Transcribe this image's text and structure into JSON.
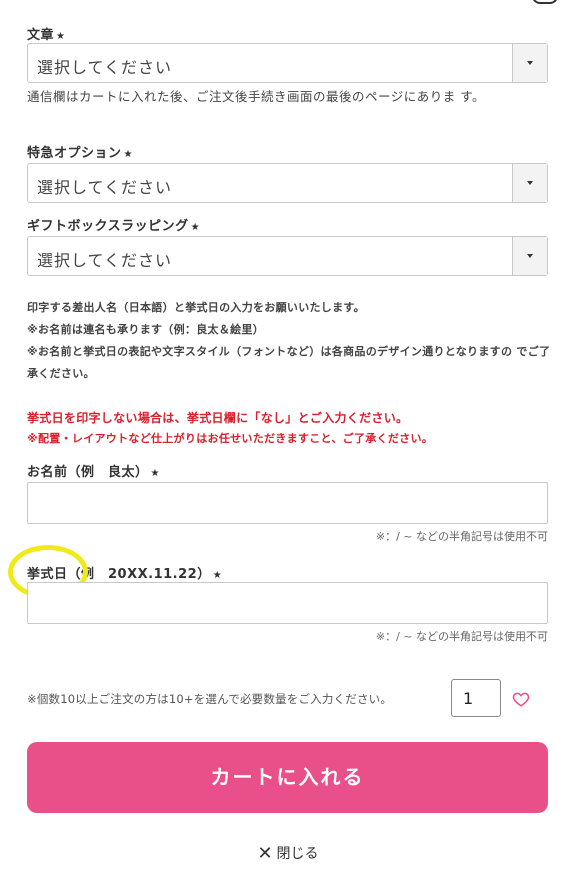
{
  "fields": {
    "sentence": {
      "label": "文章",
      "required_mark": "★",
      "selected": "選択してください",
      "note": "通信欄はカートに入れた後、ご注文後手続き画面の最後のページにありま す。"
    },
    "express": {
      "label": "特急オプション",
      "required_mark": "★",
      "selected": "選択してください"
    },
    "giftbox": {
      "label": "ギフトボックスラッピング",
      "required_mark": "★",
      "selected": "選択してください"
    }
  },
  "instructions": {
    "line1": "印字する差出人名（日本語）と挙式日の入力をお願いいたします。",
    "line2": "※お名前は連名も承ります（例：良太＆絵里）",
    "line3": "※お名前と挙式日の表記や文字スタイル（フォントなど）は各商品のデザイン通りとなりますの でご了承ください。",
    "red_line1": "挙式日を印字しない場合は、挙式日欄に「なし」とご入力ください。",
    "red_line2": "※配置・レイアウトなど仕上がりはお任せいただきますこと、ご了承ください。"
  },
  "name_field": {
    "label": "お名前（例　良太）",
    "required_mark": "★",
    "hint": "※：/ ~ などの半角記号は使用不可"
  },
  "date_field": {
    "label": "挙式日（例　20XX.11.22）",
    "required_mark": "★",
    "hint": "※：/ ~ などの半角記号は使用不可"
  },
  "quantity": {
    "note": "※個数10以上ご注文の方は10+を選んで必要数量をご入力ください。",
    "value": "1"
  },
  "cart_button": "カートに入れる",
  "close": {
    "icon": "✕",
    "label": "閉じる"
  },
  "colors": {
    "accent": "#e9508a",
    "warning": "#d9202c",
    "highlight": "#f1ea1a"
  }
}
